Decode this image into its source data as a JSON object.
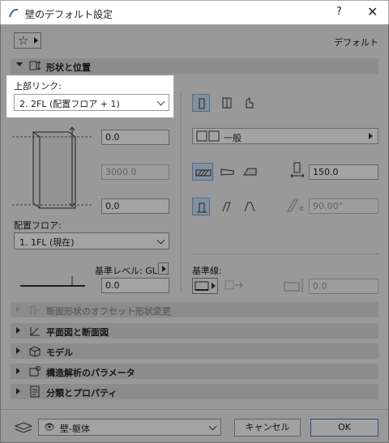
{
  "window": {
    "title": "壁のデフォルト設定",
    "help": "?",
    "close": "✕"
  },
  "favorites": {
    "default_label": "デフォルト"
  },
  "panels": {
    "geometry": {
      "label": "形状と位置"
    },
    "offset": {
      "label": "断面形状のオフセット形状変更"
    },
    "plan_section": {
      "label": "平面図と断面図"
    },
    "model": {
      "label": "モデル"
    },
    "structural": {
      "label": "構造解析のパラメータ"
    },
    "classification": {
      "label": "分類とプロパティ"
    }
  },
  "geometry": {
    "top_link_label": "上部リンク:",
    "top_link_value": "2. 2FL (配置フロア + 1)",
    "top_offset": "0.0",
    "height": "3000.0",
    "bottom_offset": "0.0",
    "home_story_label": "配置フロア:",
    "home_story_value": "1. 1FL (現在)",
    "ref_level_label": "基準レベル: GL",
    "ref_level_value": "0.0",
    "profile_type": "一般",
    "thickness": "150.0",
    "angle": "90.00°",
    "ref_line_label": "基準線:",
    "ref_line_offset": "0.0"
  },
  "footer": {
    "layer_value": "壁-躯体",
    "cancel_label": "キャンセル",
    "ok_label": "OK"
  }
}
